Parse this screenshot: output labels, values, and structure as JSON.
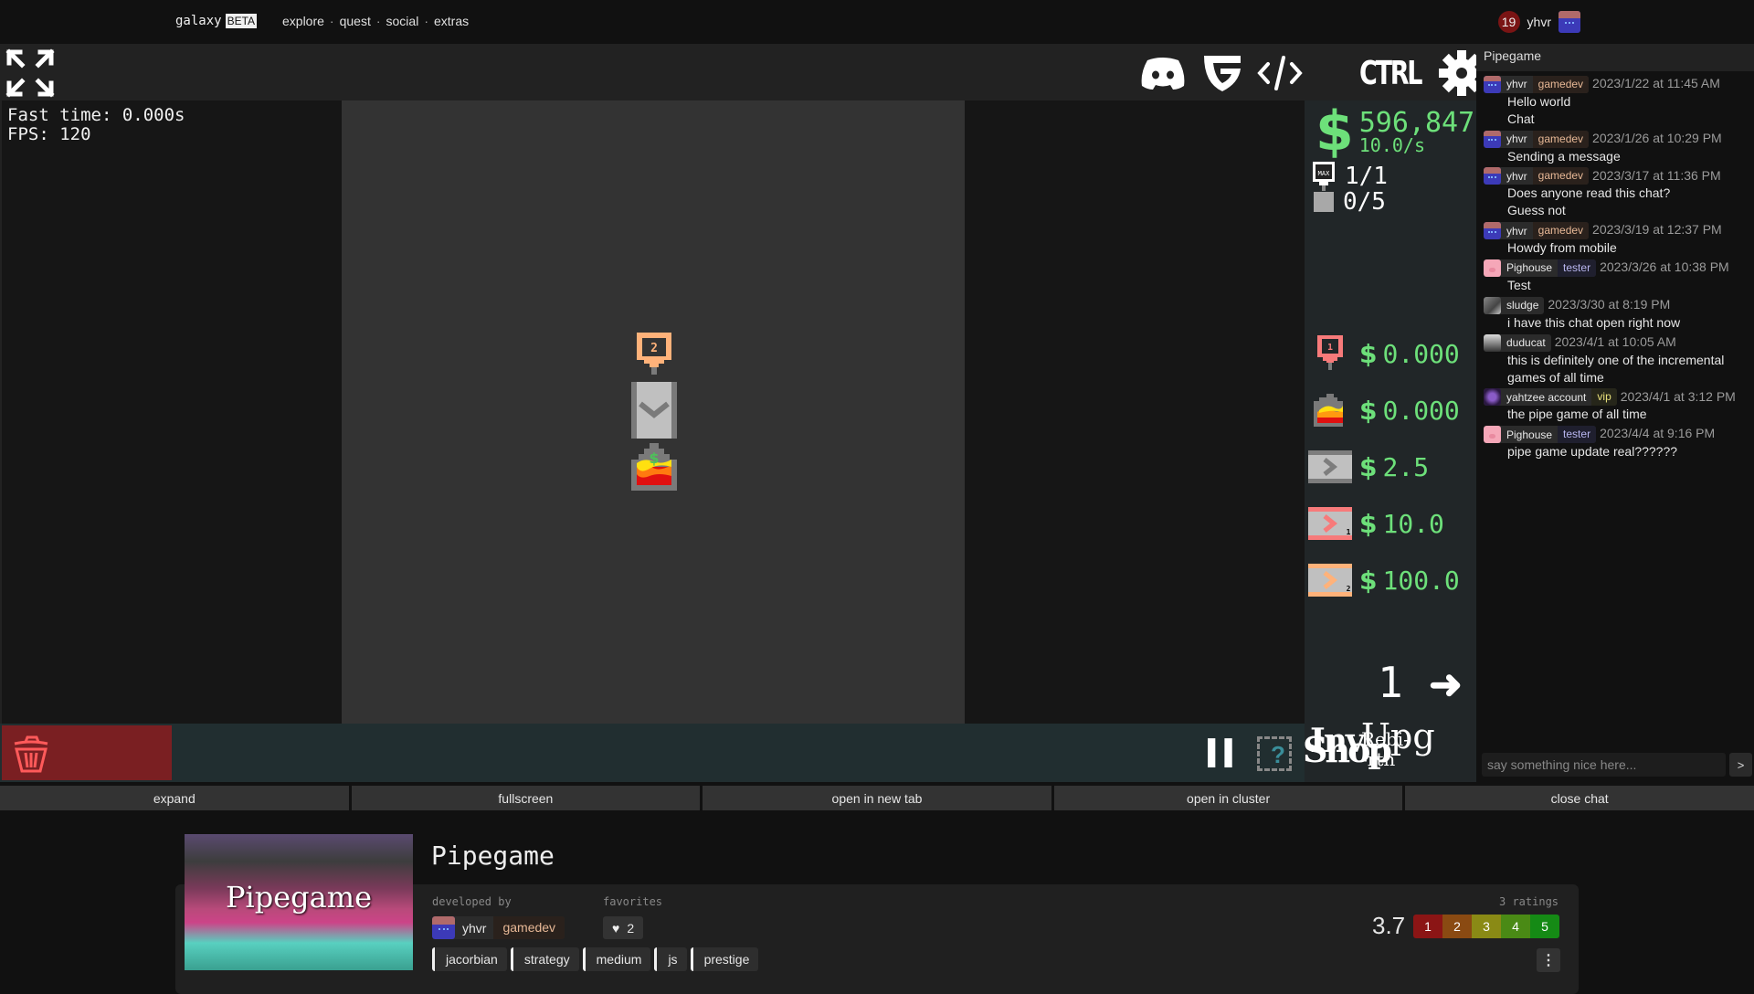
{
  "nav": {
    "brand": "galaxy",
    "beta": "BETA",
    "links": [
      "explore",
      "quest",
      "social",
      "extras"
    ],
    "separator": "·",
    "notifications": "19",
    "username": "yhvr"
  },
  "game": {
    "toolbar": {
      "ctrl_label": "CTRL",
      "icons": [
        "expand-icon",
        "discord-icon",
        "guilded-icon",
        "code-icon",
        "ctrl-icon",
        "gear-icon"
      ]
    },
    "debug": {
      "fast_time": "Fast time: 0.000s",
      "fps": "FPS: 120"
    },
    "canvas": {
      "tiles": [
        {
          "type": "spawner",
          "label": "2",
          "color": "#ffb27a"
        },
        {
          "type": "pipe-down",
          "color": "#bdbdbd"
        },
        {
          "type": "seller-fire",
          "color": "#7a7a7a"
        }
      ]
    },
    "stats": {
      "money": "596,847",
      "rate": "10.0/s",
      "spawners": "1/1",
      "pipes": "0/5"
    },
    "shop": [
      {
        "item": "spawner-1",
        "label": "1",
        "price": "0.000",
        "color": "#f77a7a"
      },
      {
        "item": "seller",
        "price": "0.000"
      },
      {
        "item": "pipe-gray",
        "price": "2.5",
        "color": "#7d7d7d"
      },
      {
        "item": "pipe-red",
        "label": "1",
        "price": "10.0",
        "color": "#f77a7a"
      },
      {
        "item": "pipe-orange",
        "label": "2",
        "price": "100.0",
        "color": "#ffb27a"
      }
    ],
    "currency_symbol": "$",
    "page": "1",
    "next_arrow": "➜",
    "menu": {
      "inv": "Inv",
      "upg": "Upg",
      "shop": "Shop",
      "rebirth_1": "Rebi-",
      "rebirth_2": "-rth",
      "pause": "II",
      "help": "?"
    }
  },
  "actions": [
    "expand",
    "fullscreen",
    "open in new tab",
    "open in cluster",
    "close chat"
  ],
  "chat": {
    "title": "Pipegame",
    "messages": [
      {
        "user": "yhvr",
        "role": "gamedev",
        "avatar": "cat",
        "time": "2023/1/22 at 11:45 AM",
        "lines": [
          "Hello world",
          "Chat"
        ]
      },
      {
        "user": "yhvr",
        "role": "gamedev",
        "avatar": "cat",
        "time": "2023/1/26 at 10:29 PM",
        "lines": [
          "Sending a message"
        ]
      },
      {
        "user": "yhvr",
        "role": "gamedev",
        "avatar": "cat",
        "time": "2023/3/17 at 11:36 PM",
        "lines": [
          "Does anyone read this chat?",
          "Guess not"
        ]
      },
      {
        "user": "yhvr",
        "role": "gamedev",
        "avatar": "cat",
        "time": "2023/3/19 at 12:37 PM",
        "lines": [
          "Howdy from mobile"
        ]
      },
      {
        "user": "Pighouse",
        "role": "tester",
        "avatar": "pig",
        "time": "2023/3/26 at 10:38 PM",
        "lines": [
          "Test"
        ]
      },
      {
        "user": "sludge",
        "role": "",
        "avatar": "sludge",
        "time": "2023/3/30 at 8:19 PM",
        "lines": [
          "i have this chat open right now"
        ]
      },
      {
        "user": "duducat",
        "role": "",
        "avatar": "duducat",
        "time": "2023/4/1 at 10:05 AM",
        "lines": [
          "this is definitely one of the incremental games of all time"
        ]
      },
      {
        "user": "yahtzee account",
        "role": "vip",
        "avatar": "yahtzee",
        "time": "2023/4/1 at 3:12 PM",
        "lines": [
          "the pipe game of all time"
        ]
      },
      {
        "user": "Pighouse",
        "role": "tester",
        "avatar": "pig",
        "time": "2023/4/4 at 9:16 PM",
        "lines": [
          "pipe game update real??????"
        ]
      }
    ],
    "input_placeholder": "say something nice here...",
    "send_label": ">"
  },
  "info": {
    "thumb_title": "Pipegame",
    "title": "Pipegame",
    "developed_by_label": "developed by",
    "developer": "yhvr",
    "developer_role": "gamedev",
    "favorites_label": "favorites",
    "favorites": "2",
    "tags": [
      "jacorbian",
      "strategy",
      "medium",
      "js",
      "prestige"
    ],
    "ratings_count": "3 ratings",
    "rating_avg": "3.7",
    "rating_options": [
      {
        "label": "1",
        "color": "#8b1515"
      },
      {
        "label": "2",
        "color": "#8a4a12"
      },
      {
        "label": "3",
        "color": "#8a8a15"
      },
      {
        "label": "4",
        "color": "#4a8a15"
      },
      {
        "label": "5",
        "color": "#158a15"
      }
    ],
    "more_label": "⋮"
  }
}
